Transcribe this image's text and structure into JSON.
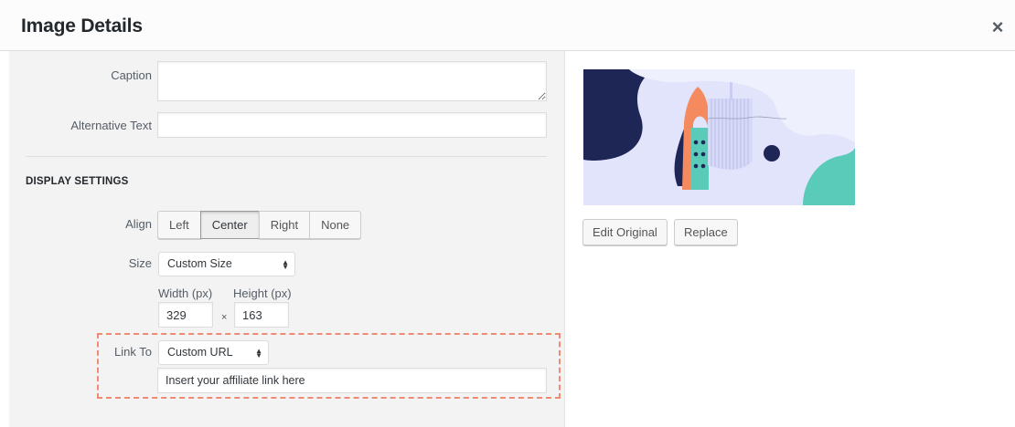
{
  "modal": {
    "title": "Image Details",
    "close_glyph": "×",
    "close_icon": "close-icon"
  },
  "form": {
    "caption_label": "Caption",
    "caption_value": "",
    "alt_label": "Alternative Text",
    "alt_value": ""
  },
  "display_settings": {
    "heading": "Display Settings",
    "align": {
      "label": "Align",
      "options": [
        "Left",
        "Center",
        "Right",
        "None"
      ],
      "selected": "Center"
    },
    "size": {
      "label": "Size",
      "selected": "Custom Size",
      "width_label": "Width (px)",
      "height_label": "Height (px)",
      "width_value": "329",
      "height_value": "163",
      "times_glyph": "×"
    },
    "link_to": {
      "label": "Link To",
      "selected": "Custom URL",
      "url_value": "Insert your affiliate link here"
    }
  },
  "preview": {
    "edit_button": "Edit Original",
    "replace_button": "Replace"
  },
  "colors": {
    "highlight_dash": "#ef8b73",
    "navy": "#1e2656",
    "orange": "#f58a5f",
    "teal": "#59cbb8",
    "lavender": "#e2e4fb"
  }
}
